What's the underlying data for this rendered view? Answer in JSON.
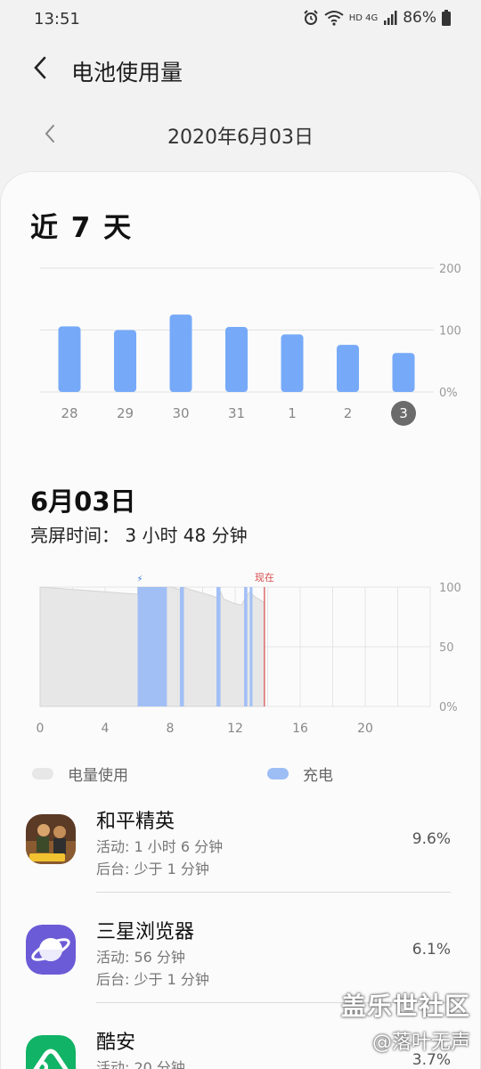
{
  "status": {
    "time": "13:51",
    "battery": "86%",
    "net": "HD 4G"
  },
  "header": {
    "title": "电池使用量"
  },
  "date_nav": {
    "date": "2020年6月03日"
  },
  "week": {
    "title": "近 7 天"
  },
  "day": {
    "title": "6月03日",
    "screen_time": "亮屏时间：  3 小时 48 分钟"
  },
  "legend": {
    "usage": "电量使用",
    "charge": "充电"
  },
  "colors": {
    "bar": "#76aaf8",
    "charge": "#9dbdf5",
    "usage_fill": "#e7e7e7",
    "now_line": "#d94b4b",
    "selected_day": "#6b6b6b"
  },
  "chart_data": [
    {
      "type": "bar",
      "title": "近 7 天",
      "categories": [
        "28",
        "29",
        "30",
        "31",
        "1",
        "2",
        "3"
      ],
      "values": [
        106,
        100,
        125,
        105,
        93,
        76,
        63
      ],
      "y_ticks": [
        "200",
        "100",
        "0%"
      ],
      "ylim": [
        0,
        200
      ],
      "selected_category": "3",
      "grid": true
    },
    {
      "type": "area",
      "x_ticks": [
        "0",
        "4",
        "8",
        "12",
        "16",
        "20"
      ],
      "y_ticks": [
        "100",
        "50",
        "0%"
      ],
      "xlim": [
        0,
        24
      ],
      "ylim": [
        0,
        100
      ],
      "now_label": "现在",
      "now_hour": 13.8,
      "charge_marker": "⚡",
      "battery_level": [
        [
          0,
          100
        ],
        [
          1,
          99
        ],
        [
          2,
          98
        ],
        [
          3,
          97
        ],
        [
          4,
          96
        ],
        [
          5,
          95
        ],
        [
          6,
          94
        ],
        [
          6.01,
          100
        ],
        [
          8.1,
          100
        ],
        [
          8.6,
          98
        ],
        [
          8.8,
          100
        ],
        [
          9.2,
          98
        ],
        [
          10,
          95
        ],
        [
          10.5,
          93
        ],
        [
          10.9,
          91
        ],
        [
          11.1,
          96
        ],
        [
          11.3,
          90
        ],
        [
          12,
          86
        ],
        [
          12.4,
          85
        ],
        [
          12.6,
          90
        ],
        [
          12.9,
          96
        ],
        [
          13.2,
          92
        ],
        [
          13.8,
          87
        ]
      ],
      "charging_intervals": [
        [
          6.0,
          7.8
        ],
        [
          8.6,
          8.85
        ],
        [
          10.85,
          11.1
        ],
        [
          12.55,
          12.75
        ],
        [
          12.9,
          13.05
        ]
      ]
    }
  ],
  "apps": [
    {
      "name": "和平精英",
      "active": "活动: 1 小时 6 分钟",
      "background": "后台: 少于 1 分钟",
      "percent": "9.6%",
      "icon": "game-icon"
    },
    {
      "name": "三星浏览器",
      "active": "活动: 56 分钟",
      "background": "后台: 少于 1 分钟",
      "percent": "6.1%",
      "icon": "planet-icon"
    },
    {
      "name": "酷安",
      "active": "活动: 20 分钟",
      "background": "",
      "percent": "3.7%",
      "icon": "coolapk-icon"
    }
  ],
  "watermark": {
    "line1": "盖乐世社区",
    "line2": "@落叶无声"
  }
}
